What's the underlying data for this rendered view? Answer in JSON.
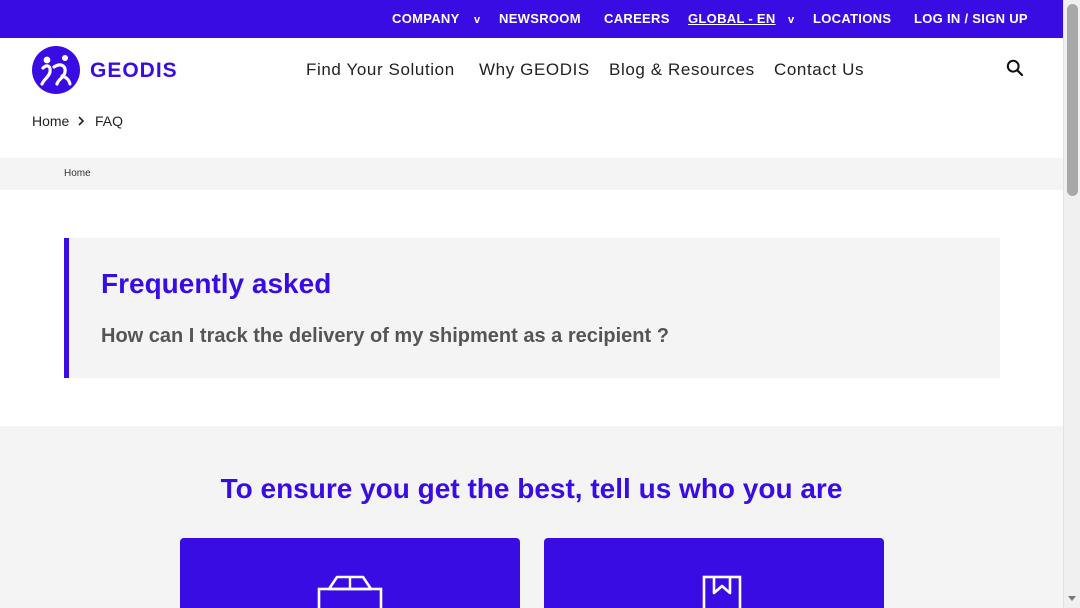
{
  "colors": {
    "brand": "#3a0ce4",
    "panel": "#f4f4f4",
    "question": "#555555"
  },
  "topbar": {
    "company": "COMPANY",
    "newsroom": "NEWSROOM",
    "careers": "CAREERS",
    "global": "GLOBAL - EN",
    "locations": "LOCATIONS",
    "login": "LOG IN / SIGN UP",
    "caret": "v"
  },
  "header": {
    "logo_text": "GEODIS",
    "nav": {
      "find": "Find Your Solution",
      "why": "Why GEODIS",
      "blog": "Blog & Resources",
      "contact": "Contact Us"
    },
    "search_icon": "search-icon"
  },
  "breadcrumb": {
    "home": "Home",
    "current": "FAQ"
  },
  "band": {
    "home": "Home"
  },
  "faq": {
    "title": "Frequently asked",
    "question": "How can I track the delivery of my shipment as a recipient ?"
  },
  "audience": {
    "heading": "To ensure you get the best, tell us who you are",
    "tiles": [
      {
        "icon": "box-icon"
      },
      {
        "icon": "bookmark-icon"
      }
    ]
  }
}
